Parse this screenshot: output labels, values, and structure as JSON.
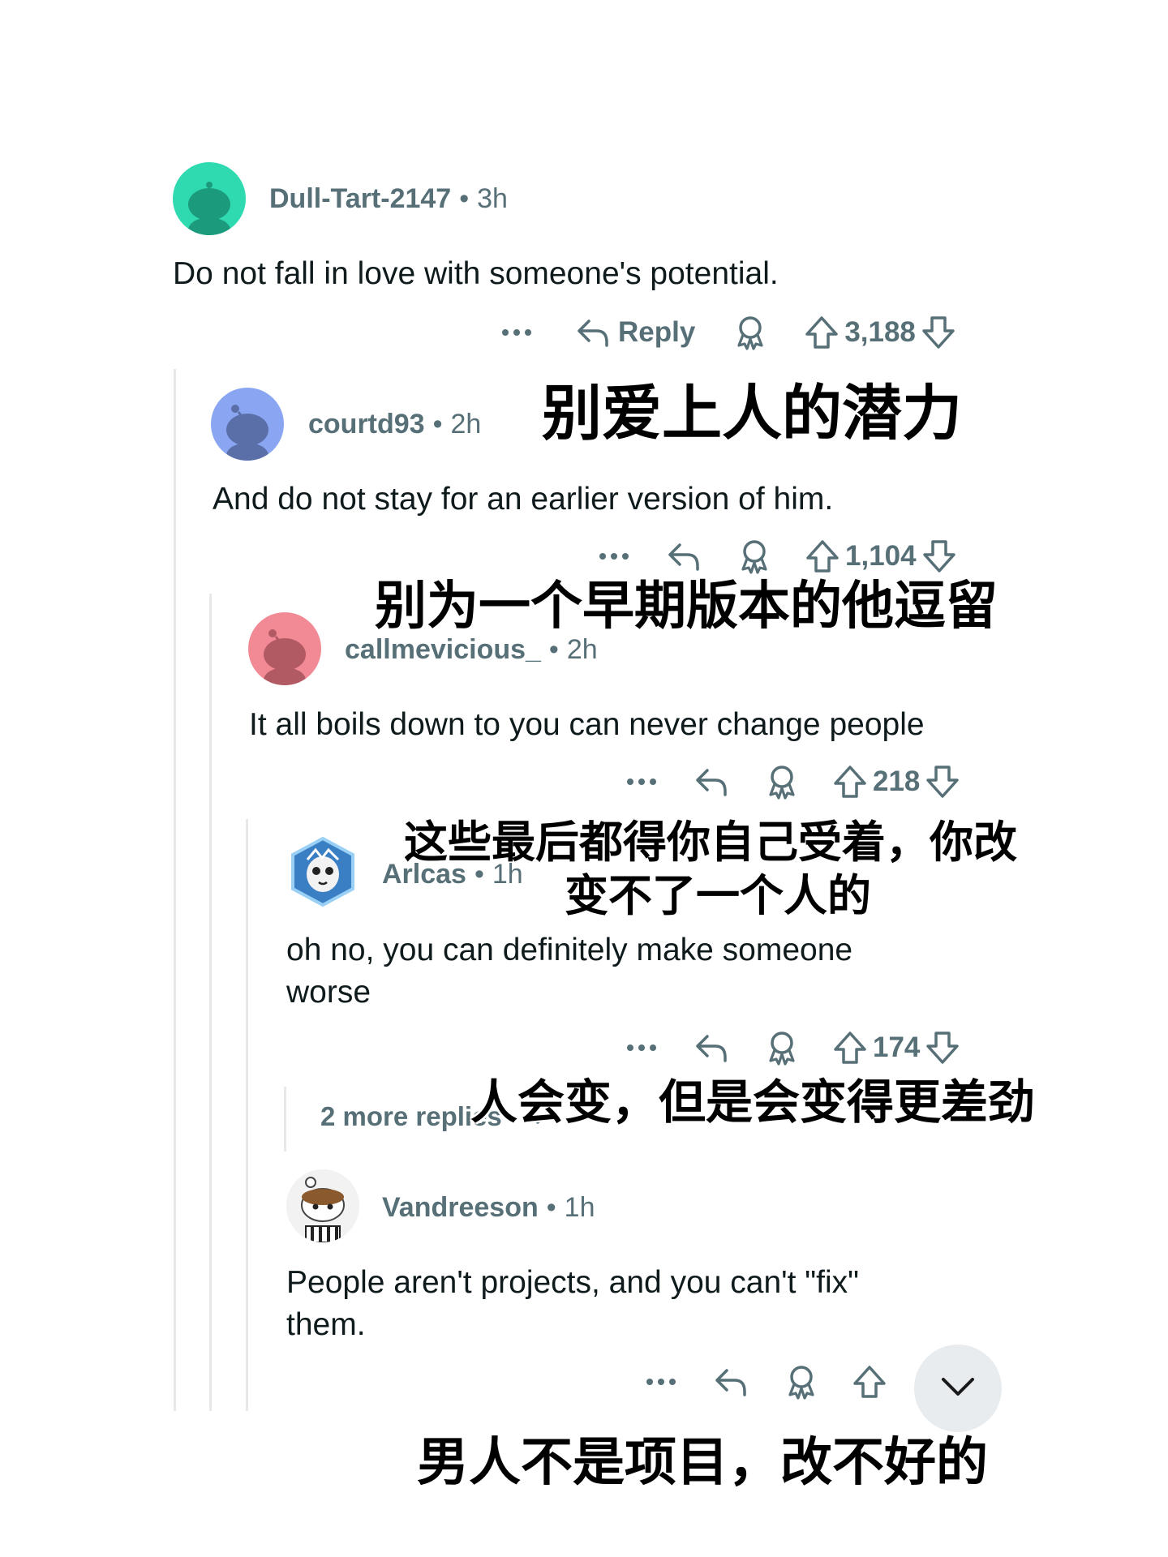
{
  "comments": [
    {
      "user": "Dull-Tart-2147",
      "time": "3h",
      "text": "Do not fall in love with someone's potential.",
      "reply_label": "Reply",
      "score": "3,188",
      "avatar_color": "#2fdab0",
      "translation": "别爱上人的潜力"
    },
    {
      "user": "courtd93",
      "time": "2h",
      "text": "And do not stay for an earlier version of him.",
      "score": "1,104",
      "avatar_color": "#8aa6f3",
      "translation": "别为一个早期版本的他逗留"
    },
    {
      "user": "callmevicious_",
      "time": "2h",
      "text": "It all boils down to you can never change people",
      "score": "218",
      "avatar_color": "#f28a96",
      "translation_line1": "这些最后都得你自己受着，你改",
      "translation_line2": "变不了一个人的"
    },
    {
      "user": "Arlcas",
      "time": "1h",
      "text_line1": "oh no, you can definitely make someone",
      "text_line2": "worse",
      "score": "174",
      "translation": "人会变，但是会变得更差劲"
    },
    {
      "more_replies": "2 more replies"
    },
    {
      "user": "Vandreeson",
      "time": "1h",
      "text_line1": "People aren't projects, and you can't \"fix\"",
      "text_line2": "them.",
      "translation": "男人不是项目，改不好的"
    }
  ],
  "icons": [
    "more-options-icon",
    "reply-icon",
    "award-icon",
    "upvote-icon",
    "downvote-icon",
    "chevron-down-icon"
  ]
}
